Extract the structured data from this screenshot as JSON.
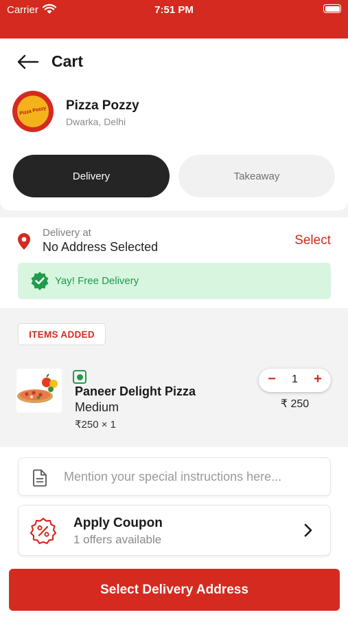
{
  "status_bar": {
    "carrier": "Carrier",
    "time": "7:51 PM"
  },
  "header": {
    "title": "Cart"
  },
  "restaurant": {
    "name": "Pizza Pozzy",
    "location": "Dwarka, Delhi",
    "logo_text": "Pizza Pozzy",
    "modes": [
      {
        "label": "Delivery",
        "selected": true
      },
      {
        "label": "Takeaway",
        "selected": false
      }
    ]
  },
  "address": {
    "label": "Delivery at",
    "value": "No Address Selected",
    "action": "Select",
    "free_delivery": "Yay! Free Delivery"
  },
  "items": {
    "tag": "ITEMS ADDED",
    "list": [
      {
        "name": "Paneer Delight Pizza",
        "size": "Medium",
        "unit_calc": "₹250 × 1",
        "quantity": "1",
        "price": "₹ 250",
        "veg": true
      }
    ]
  },
  "instructions": {
    "placeholder": "Mention your special instructions here..."
  },
  "coupon": {
    "title": "Apply Coupon",
    "subtitle": "1 offers available"
  },
  "cta": {
    "label": "Select Delivery Address"
  },
  "colors": {
    "brand": "#d52a1f",
    "success": "#1a9a4a",
    "success_bg": "#d8f5df",
    "dark_button": "#252525"
  }
}
